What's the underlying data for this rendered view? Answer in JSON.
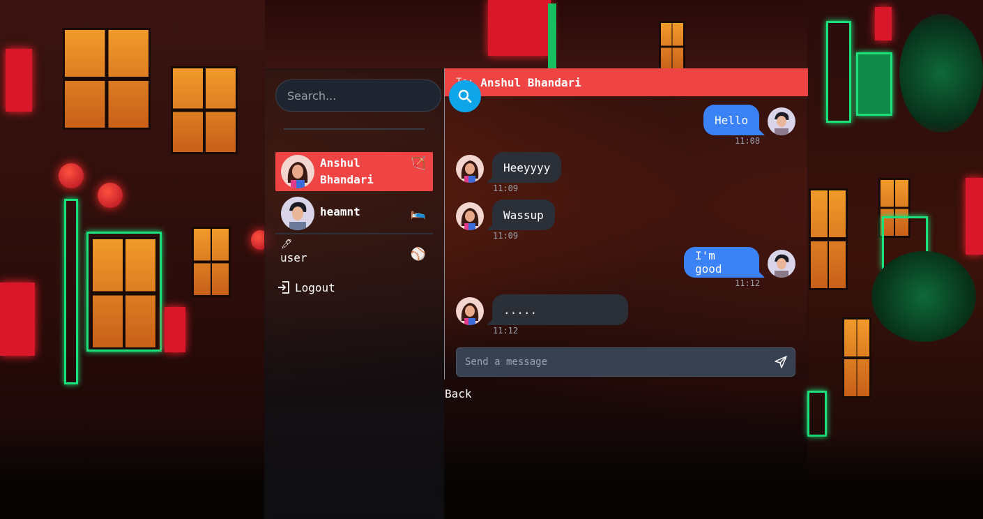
{
  "search": {
    "placeholder": "Search..."
  },
  "contacts": [
    {
      "name": "Anshul Bhandari",
      "name_line1": "Anshul",
      "name_line2": "Bhandari",
      "emoji": "🏹",
      "active": true
    },
    {
      "name": "heamnt",
      "emoji": "🛌",
      "active": false
    },
    {
      "name": "user",
      "emoji": "⚾",
      "active": false
    }
  ],
  "logout_label": "Logout",
  "chat": {
    "to_label": "To:",
    "recipient": "Anshul Bhandari",
    "messages": [
      {
        "text": "Hello",
        "time": "11:08",
        "direction": "out"
      },
      {
        "text": "Heeyyyy",
        "time": "11:09",
        "direction": "in"
      },
      {
        "text": "Wassup",
        "time": "11:09",
        "direction": "in"
      },
      {
        "text": "I'm good",
        "time": "11:12",
        "direction": "out"
      },
      {
        "text": ".....",
        "time": "11:12",
        "direction": "in"
      }
    ],
    "composer_placeholder": "Send a message",
    "back_label": "Back"
  },
  "colors": {
    "accent": "#ef4444",
    "outgoing": "#3b82f6",
    "incoming": "#2a2f38",
    "search_button": "#0ea5e9"
  }
}
